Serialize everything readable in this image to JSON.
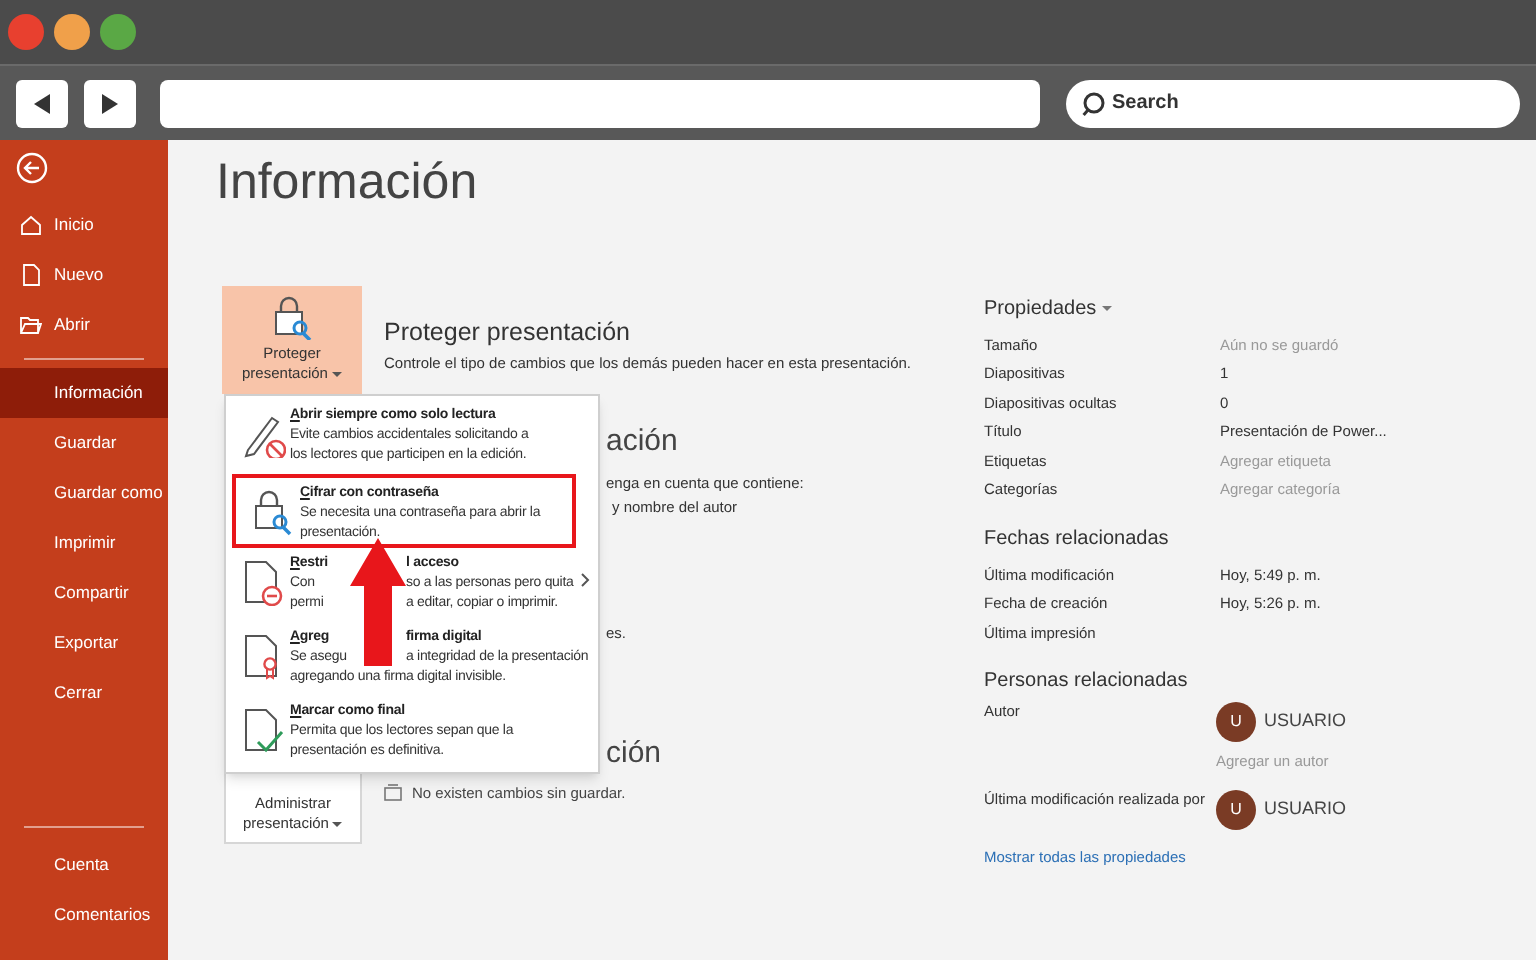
{
  "browser": {
    "search_placeholder": "Search"
  },
  "nav": {
    "top": [
      {
        "kind": "home",
        "label": "Inicio",
        "selected": false
      },
      {
        "kind": "new",
        "label": "Nuevo",
        "selected": false
      },
      {
        "kind": "open",
        "label": "Abrir",
        "selected": false
      }
    ],
    "middle": [
      {
        "label": "Información",
        "selected": true
      },
      {
        "label": "Guardar",
        "selected": false
      },
      {
        "label": "Guardar como",
        "selected": false
      },
      {
        "label": "Imprimir",
        "selected": false
      },
      {
        "label": "Compartir",
        "selected": false
      },
      {
        "label": "Exportar",
        "selected": false
      },
      {
        "label": "Cerrar",
        "selected": false
      }
    ],
    "bottom": [
      {
        "label": "Cuenta",
        "selected": false
      },
      {
        "label": "Comentarios",
        "selected": false
      }
    ]
  },
  "page_title": "Información",
  "protect": {
    "button_label": "Proteger presentación",
    "heading": "Proteger presentación",
    "description": "Controle el tipo de cambios que los demás pueden hacer en esta presentación."
  },
  "protect_menu": [
    {
      "kind": "readonly",
      "highlighted": false,
      "submenu": false,
      "title": [
        "Abrir siempre como solo lectura"
      ],
      "description": [
        [
          "Evite cambios accidentales solicitando a"
        ],
        [
          "los lectores que participen en la edición."
        ]
      ]
    },
    {
      "kind": "password",
      "highlighted": true,
      "submenu": false,
      "title": [
        "Cifrar con contraseña"
      ],
      "description": [
        [
          "Se necesita una contraseña para abrir la"
        ],
        [
          "presentación."
        ]
      ]
    },
    {
      "kind": "restrict",
      "highlighted": false,
      "submenu": true,
      "title": [
        "Restri",
        "l acceso"
      ],
      "description": [
        [
          "Con",
          "so a las personas pero quita"
        ],
        [
          "permi",
          "a editar, copiar o imprimir."
        ]
      ]
    },
    {
      "kind": "signature",
      "highlighted": false,
      "submenu": false,
      "title": [
        "Agreg",
        "firma digital"
      ],
      "description": [
        [
          "Se asegu",
          "a integridad de la presentación"
        ],
        [
          "agregando una firma digital invisible."
        ]
      ]
    },
    {
      "kind": "final",
      "highlighted": false,
      "submenu": false,
      "title": [
        "Marcar como final"
      ],
      "description": [
        [
          "Permita que los lectores sepan que la"
        ],
        [
          "presentación es definitiva."
        ]
      ]
    }
  ],
  "covered_fragments": [
    {
      "kind": "heading",
      "text": "ación"
    },
    {
      "kind": "text",
      "text": "enga en cuenta que contiene:"
    },
    {
      "kind": "text",
      "text": "y nombre del autor"
    },
    {
      "kind": "text",
      "text": "es."
    },
    {
      "kind": "heading",
      "text": "ción"
    }
  ],
  "manage": {
    "button_label": "Administrar presentación",
    "status": "No existen cambios sin guardar."
  },
  "properties": {
    "heading": "Propiedades",
    "rows": [
      {
        "label": "Tamaño",
        "value": "Aún no se guardó",
        "muted": true
      },
      {
        "label": "Diapositivas",
        "value": "1",
        "muted": false
      },
      {
        "label": "Diapositivas ocultas",
        "value": "0",
        "muted": false
      },
      {
        "label": "Título",
        "value": "Presentación de Power...",
        "muted": false
      },
      {
        "label": "Etiquetas",
        "value": "Agregar etiqueta",
        "muted": true
      },
      {
        "label": "Categorías",
        "value": "Agregar categoría",
        "muted": true
      }
    ]
  },
  "dates": {
    "heading": "Fechas relacionadas",
    "rows": [
      {
        "label": "Última modificación",
        "value": "Hoy, 5:49 p. m."
      },
      {
        "label": "Fecha de creación",
        "value": "Hoy, 5:26 p. m."
      },
      {
        "label": "Última impresión"
      }
    ]
  },
  "people": {
    "heading": "Personas relacionadas",
    "rows": [
      {
        "label": "Autor",
        "initial": "U",
        "name": "USUARIO",
        "add_link": "Agregar un autor"
      },
      {
        "label": "Última modificación realizada por",
        "initial": "U",
        "name": "USUARIO"
      }
    ]
  },
  "show_all_link": "Mostrar todas las propiedades"
}
